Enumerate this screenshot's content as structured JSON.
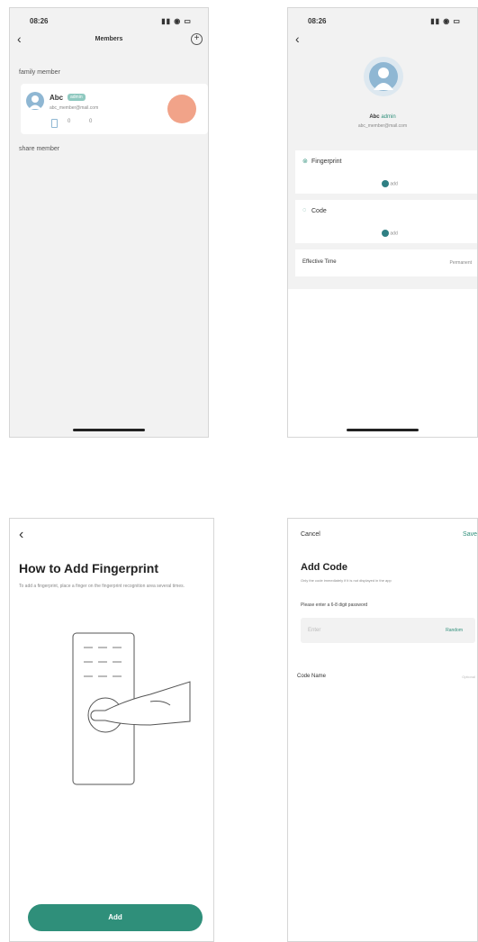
{
  "screen1": {
    "status_time": "08:26",
    "status_icons": "▮▮ ◉ ▭",
    "title": "Members",
    "section_family": "family member",
    "member_name": "Abc",
    "member_role": "admin",
    "member_sub": "abc_member@mail.com",
    "member_stats": [
      "0",
      "0"
    ],
    "section_share": "share member"
  },
  "screen2": {
    "status_time": "08:26",
    "status_icons": "▮▮ ◉ ▭",
    "profile_name": "Abc",
    "profile_role": "admin",
    "profile_sub": "abc_member@mail.com",
    "fingerprint_label": "Fingerprint",
    "fingerprint_add": "add",
    "code_label": "Code",
    "code_add": "add",
    "effective_label": "Effective Time",
    "effective_value": "Permanent"
  },
  "screen3": {
    "title": "How to Add Fingerprint",
    "description": "To add a fingerprint, place a finger on the fingerprint recognition area several times.",
    "add_button": "Add"
  },
  "screen4": {
    "cancel": "Cancel",
    "save": "Save",
    "title": "Add Code",
    "subtitle": "Only the code immediately if it is not displayed in the app",
    "prompt": "Please enter a 6-8 digit password",
    "input_placeholder": "Enter",
    "random_label": "Random",
    "code_name_label": "Code Name",
    "code_name_placeholder": "Optional"
  },
  "colors": {
    "accent": "#2f8f7a",
    "avatar": "#8fb7d3",
    "orange_dot": "#f1a389"
  }
}
